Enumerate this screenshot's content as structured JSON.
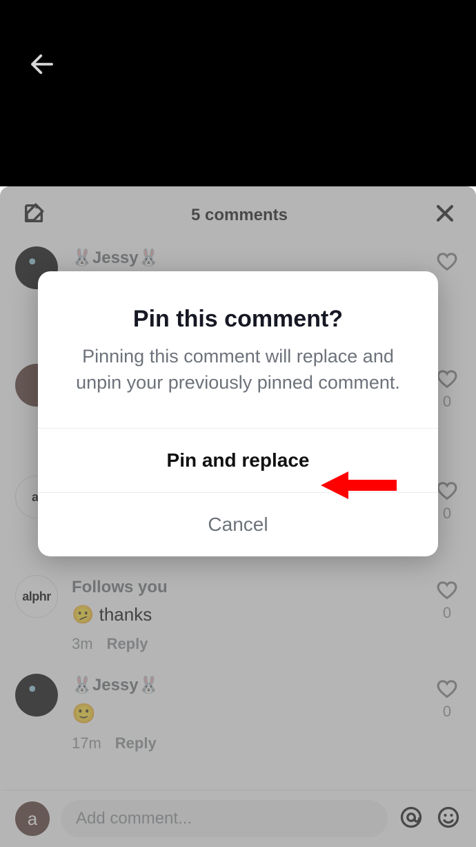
{
  "sheet": {
    "title": "5 comments"
  },
  "comments": [
    {
      "name": "🐰Jessy🐰",
      "text": "",
      "time": "",
      "likes": "",
      "avatar": "jessy",
      "follows": ""
    },
    {
      "name": "",
      "text": "",
      "time": "",
      "likes": "0",
      "avatar": "brown",
      "follows": ""
    },
    {
      "name": "",
      "text": "",
      "time": "",
      "likes": "0",
      "avatar": "alphr",
      "avatarText": "al",
      "follows": ""
    },
    {
      "name": "",
      "text": "🫤 thanks",
      "time": "3m",
      "likes": "0",
      "avatar": "alphr",
      "avatarText": "alphr",
      "follows": "Follows you"
    },
    {
      "name": "🐰Jessy🐰",
      "text": "🙂",
      "time": "17m",
      "likes": "0",
      "avatar": "jessy",
      "follows": ""
    }
  ],
  "reply_label": "Reply",
  "input": {
    "avatar_letter": "a",
    "placeholder": "Add comment..."
  },
  "modal": {
    "title": "Pin this comment?",
    "body": "Pinning this comment will replace and unpin your previously pinned comment.",
    "primary": "Pin and replace",
    "secondary": "Cancel"
  }
}
